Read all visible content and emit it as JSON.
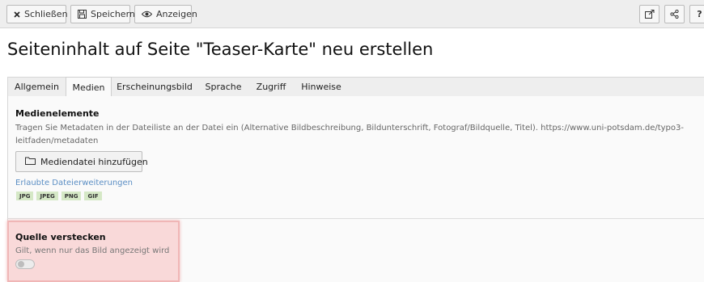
{
  "toolbar": {
    "close_label": "Schließen",
    "save_label": "Speichern",
    "view_label": "Anzeigen",
    "right_icons": [
      "external-link-icon",
      "share-icon",
      "help-icon"
    ],
    "help_glyph": "?"
  },
  "page_title": "Seiteninhalt auf Seite \"Teaser-Karte\" neu erstellen",
  "tabs": [
    {
      "label": "Allgemein",
      "active": false
    },
    {
      "label": "Medien",
      "active": true
    },
    {
      "label": "Erscheinungsbild",
      "active": false
    },
    {
      "label": "Sprache",
      "active": false
    },
    {
      "label": "Zugriff",
      "active": false
    },
    {
      "label": "Hinweise",
      "active": false
    }
  ],
  "media": {
    "title": "Medienelemente",
    "description": "Tragen Sie Metadaten in der Dateiliste an der Datei ein (Alternative Bildbeschreibung, Bildunterschrift, Fotograf/Bildquelle, Titel). https://www.uni-potsdam.de/typo3-leitfaden/metadaten",
    "add_button_label": "Mediendatei hinzufügen",
    "allowed_label": "Erlaubte Dateierweiterungen",
    "extensions": [
      "JPG",
      "JPEG",
      "PNG",
      "GIF"
    ]
  },
  "hide_source": {
    "label": "Quelle verstecken",
    "description": "Gilt, wenn nur das Bild angezeigt wird",
    "checked": false
  },
  "colors": {
    "badge_bg": "#d5e8c6",
    "link": "#5b8ec4",
    "highlight_bg": "#f9d9d9",
    "highlight_border": "#f0b6b6"
  }
}
